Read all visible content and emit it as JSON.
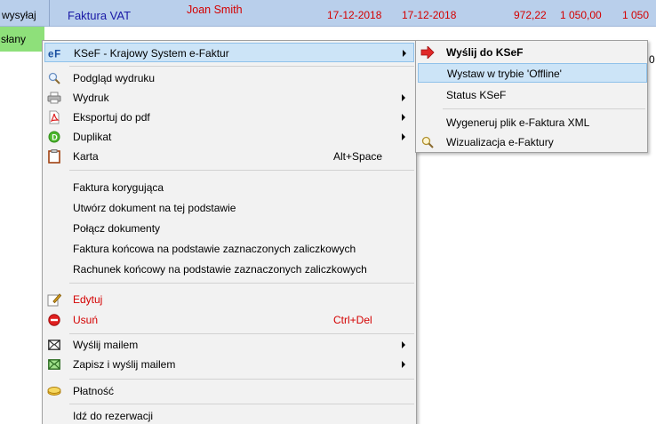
{
  "grid": {
    "row1": {
      "status": "wysyłaj",
      "doc_type": "Faktura VAT",
      "customer": "Joan Smith",
      "date_issue": "17-12-2018",
      "date_sale": "17-12-2018",
      "net": "972,22",
      "gross": "1 050,00",
      "extra": "1 050"
    },
    "row2": {
      "status": "słany",
      "extra": "0"
    }
  },
  "context_menu": {
    "items": [
      {
        "label": "KSeF - Krajowy System e-Faktur",
        "icon": "ef-icon",
        "submenu": true
      },
      {
        "label": "Podgląd wydruku",
        "icon": "magnifier-icon"
      },
      {
        "label": "Wydruk",
        "icon": "printer-icon",
        "submenu": true
      },
      {
        "label": "Eksportuj do pdf",
        "icon": "pdf-icon",
        "submenu": true
      },
      {
        "label": "Duplikat",
        "icon": "duplicate-icon",
        "submenu": true
      },
      {
        "label": "Karta",
        "icon": "card-icon",
        "shortcut": "Alt+Space"
      },
      {
        "label": "Faktura korygująca"
      },
      {
        "label": "Utwórz dokument na tej podstawie"
      },
      {
        "label": "Połącz dokumenty"
      },
      {
        "label": "Faktura końcowa na podstawie zaznaczonych zaliczkowych"
      },
      {
        "label": "Rachunek końcowy na podstawie zaznaczonych zaliczkowych"
      },
      {
        "label": "Edytuj",
        "icon": "edit-icon"
      },
      {
        "label": "Usuń",
        "icon": "delete-icon",
        "shortcut": "Ctrl+Del"
      },
      {
        "label": "Wyślij mailem",
        "icon": "mail-icon",
        "submenu": true
      },
      {
        "label": "Zapisz i wyślij mailem",
        "icon": "mail-save-icon",
        "submenu": true
      },
      {
        "label": "Płatność",
        "icon": "payment-icon"
      },
      {
        "label": "Idź do rezerwacji"
      }
    ]
  },
  "ksef_submenu": {
    "items": [
      {
        "label": "Wyślij do KSeF",
        "icon": "send-arrow-icon"
      },
      {
        "label": "Wystaw w trybie 'Offline'"
      },
      {
        "label": "Status KSeF"
      },
      {
        "label": "Wygeneruj plik e-Faktura XML"
      },
      {
        "label": "Wizualizacja e-Faktury",
        "icon": "magnifier-icon"
      }
    ]
  },
  "colors": {
    "grid_row_bg": "#b9cfeb",
    "grid_row2_bg": "#8ee07a",
    "menu_bg": "#f2f2f2",
    "highlight": "#cce4f7",
    "red_text": "#d40000",
    "blue_text": "#1a1aa6"
  }
}
